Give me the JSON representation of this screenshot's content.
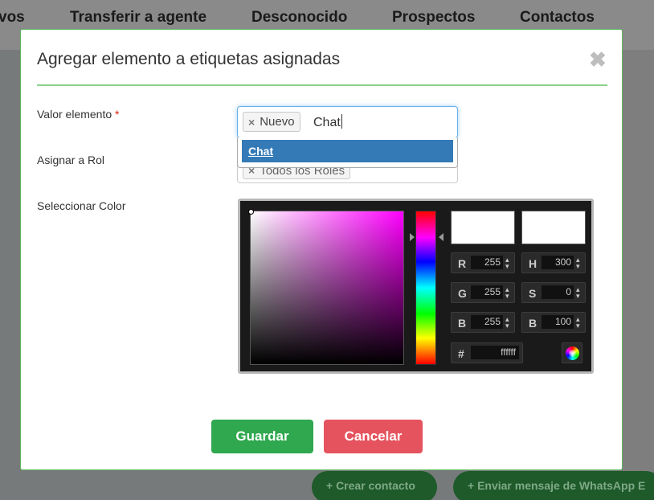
{
  "background": {
    "tabs": [
      "vos",
      "Transferir a agente",
      "Desconocido",
      "Prospectos",
      "Contactos"
    ],
    "buttons": {
      "create_contact": "+ Crear contacto",
      "send_whatsapp": "+ Enviar mensaje de WhatsApp E"
    }
  },
  "modal": {
    "title": "Agregar elemento a etiquetas asignadas",
    "close_glyph": "✖",
    "fields": {
      "valor_label": "Valor elemento",
      "required_mark": "*",
      "rol_label": "Asignar a Rol",
      "color_label": "Seleccionar Color"
    },
    "tag_input": {
      "chip_remove": "×",
      "chip_label": "Nuevo",
      "typed_text": "Chat"
    },
    "dropdown": {
      "highlighted_option": "Chat"
    },
    "role": {
      "chip_remove": "×",
      "chip_label": "Todos los Roles"
    },
    "color_picker": {
      "current_color": "#ffffff",
      "new_color": "#ffffff",
      "r_label": "R",
      "r_value": "255",
      "g_label": "G",
      "g_value": "255",
      "b_label": "B",
      "b_value": "255",
      "h_label": "H",
      "h_value": "300",
      "s_label": "S",
      "s_value": "0",
      "b2_label": "B",
      "b2_value": "100",
      "hex_label": "#",
      "hex_value": "ffffff"
    },
    "buttons": {
      "save": "Guardar",
      "cancel": "Cancelar"
    }
  }
}
